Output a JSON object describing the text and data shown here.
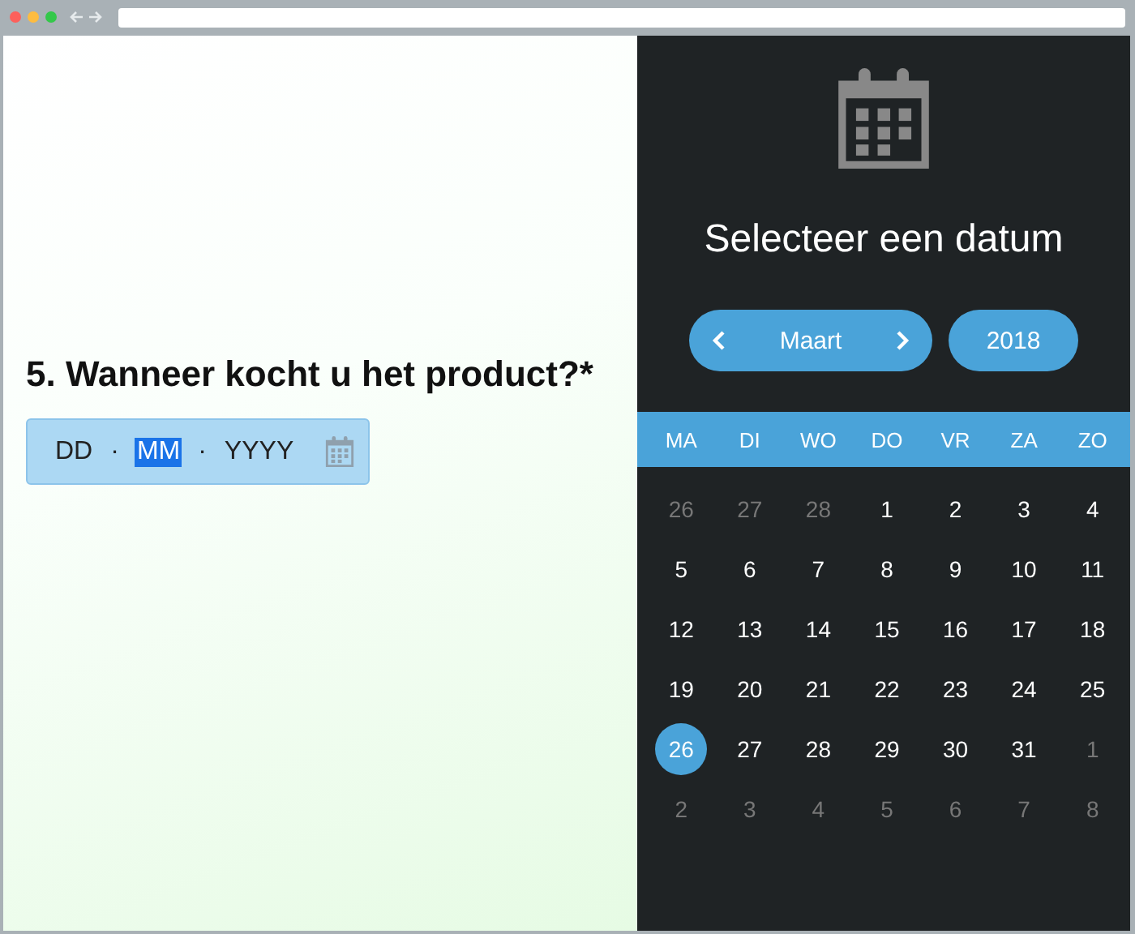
{
  "browser": {
    "traffic_lights": [
      {
        "color": "#fc605c"
      },
      {
        "color": "#fdbc40"
      },
      {
        "color": "#34c84a"
      }
    ]
  },
  "question": {
    "title": "5. Wanneer kocht u het product?*",
    "date_field": {
      "segments": [
        {
          "kind": "part",
          "label": "DD",
          "selected": false
        },
        {
          "kind": "sep",
          "label": "·"
        },
        {
          "kind": "part",
          "label": "MM",
          "selected": true
        },
        {
          "kind": "sep",
          "label": "·"
        },
        {
          "kind": "part",
          "label": "YYYY",
          "selected": false
        }
      ]
    }
  },
  "picker": {
    "title": "Selecteer een datum",
    "month": "Maart",
    "year": "2018",
    "weekdays": [
      "MA",
      "DI",
      "WO",
      "DO",
      "VR",
      "ZA",
      "ZO"
    ],
    "weeks": [
      [
        {
          "label": "26",
          "muted": true,
          "selected": false
        },
        {
          "label": "27",
          "muted": true,
          "selected": false
        },
        {
          "label": "28",
          "muted": true,
          "selected": false
        },
        {
          "label": "1",
          "muted": false,
          "selected": false
        },
        {
          "label": "2",
          "muted": false,
          "selected": false
        },
        {
          "label": "3",
          "muted": false,
          "selected": false
        },
        {
          "label": "4",
          "muted": false,
          "selected": false
        }
      ],
      [
        {
          "label": "5",
          "muted": false,
          "selected": false
        },
        {
          "label": "6",
          "muted": false,
          "selected": false
        },
        {
          "label": "7",
          "muted": false,
          "selected": false
        },
        {
          "label": "8",
          "muted": false,
          "selected": false
        },
        {
          "label": "9",
          "muted": false,
          "selected": false
        },
        {
          "label": "10",
          "muted": false,
          "selected": false
        },
        {
          "label": "11",
          "muted": false,
          "selected": false
        }
      ],
      [
        {
          "label": "12",
          "muted": false,
          "selected": false
        },
        {
          "label": "13",
          "muted": false,
          "selected": false
        },
        {
          "label": "14",
          "muted": false,
          "selected": false
        },
        {
          "label": "15",
          "muted": false,
          "selected": false
        },
        {
          "label": "16",
          "muted": false,
          "selected": false
        },
        {
          "label": "17",
          "muted": false,
          "selected": false
        },
        {
          "label": "18",
          "muted": false,
          "selected": false
        }
      ],
      [
        {
          "label": "19",
          "muted": false,
          "selected": false
        },
        {
          "label": "20",
          "muted": false,
          "selected": false
        },
        {
          "label": "21",
          "muted": false,
          "selected": false
        },
        {
          "label": "22",
          "muted": false,
          "selected": false
        },
        {
          "label": "23",
          "muted": false,
          "selected": false
        },
        {
          "label": "24",
          "muted": false,
          "selected": false
        },
        {
          "label": "25",
          "muted": false,
          "selected": false
        }
      ],
      [
        {
          "label": "26",
          "muted": false,
          "selected": true
        },
        {
          "label": "27",
          "muted": false,
          "selected": false
        },
        {
          "label": "28",
          "muted": false,
          "selected": false
        },
        {
          "label": "29",
          "muted": false,
          "selected": false
        },
        {
          "label": "30",
          "muted": false,
          "selected": false
        },
        {
          "label": "31",
          "muted": false,
          "selected": false
        },
        {
          "label": "1",
          "muted": true,
          "selected": false
        }
      ],
      [
        {
          "label": "2",
          "muted": true,
          "selected": false
        },
        {
          "label": "3",
          "muted": true,
          "selected": false
        },
        {
          "label": "4",
          "muted": true,
          "selected": false
        },
        {
          "label": "5",
          "muted": true,
          "selected": false
        },
        {
          "label": "6",
          "muted": true,
          "selected": false
        },
        {
          "label": "7",
          "muted": true,
          "selected": false
        },
        {
          "label": "8",
          "muted": true,
          "selected": false
        }
      ]
    ]
  }
}
